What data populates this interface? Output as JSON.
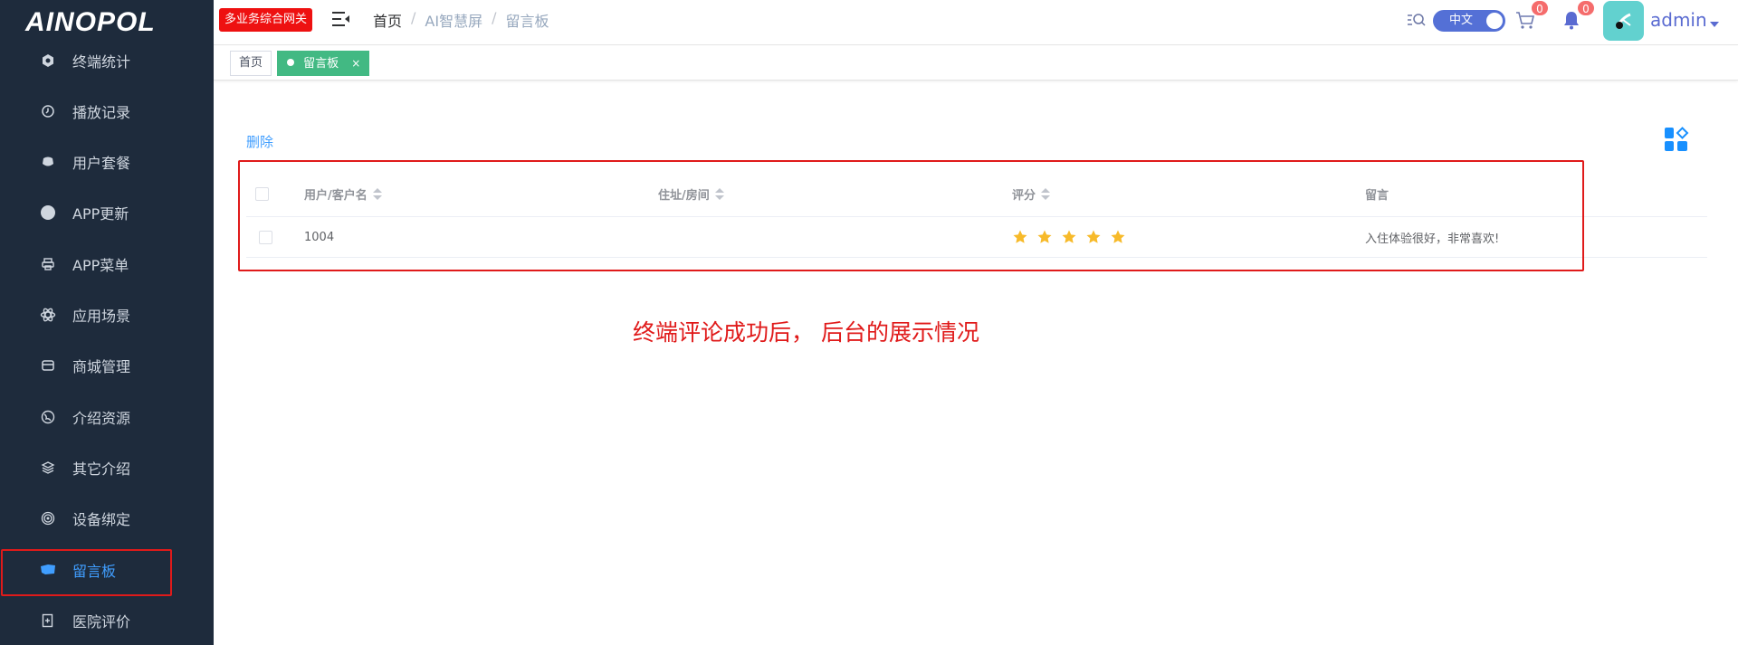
{
  "app": {
    "logo": "AINOPOL",
    "gateway_badge": "多业务综合网关"
  },
  "breadcrumb": [
    "首页",
    "AI智慧屏",
    "留言板"
  ],
  "header": {
    "lang_label": "中文",
    "cart_count": "0",
    "bell_count": "0",
    "username": "admin"
  },
  "sidebar": {
    "items": [
      {
        "label": "终端统计",
        "icon": "hexagon-icon"
      },
      {
        "label": "播放记录",
        "icon": "clock-icon"
      },
      {
        "label": "用户套餐",
        "icon": "package-icon"
      },
      {
        "label": "APP更新",
        "icon": "circle-icon"
      },
      {
        "label": "APP菜单",
        "icon": "printer-icon"
      },
      {
        "label": "应用场景",
        "icon": "atom-icon"
      },
      {
        "label": "商城管理",
        "icon": "shop-icon"
      },
      {
        "label": "介绍资源",
        "icon": "globe-icon"
      },
      {
        "label": "其它介绍",
        "icon": "layers-icon"
      },
      {
        "label": "设备绑定",
        "icon": "target-icon"
      },
      {
        "label": "留言板",
        "icon": "message-icon",
        "active": true
      },
      {
        "label": "医院评价",
        "icon": "document-icon"
      }
    ]
  },
  "tags": [
    {
      "label": "首页"
    },
    {
      "label": "留言板",
      "active": true,
      "close": "×"
    }
  ],
  "toolbar": {
    "delete_label": "删除"
  },
  "table": {
    "columns": [
      "用户/客户名",
      "住址/房间",
      "评分",
      "留言"
    ],
    "rows": [
      {
        "user": "1004",
        "address": "",
        "rating": 5,
        "message": "入住体验很好，非常喜欢!"
      }
    ]
  },
  "annotation": "终端评论成功后， 后台的展示情况",
  "colors": {
    "sidebar_bg": "#1e2b3c",
    "accent": "#409eff",
    "tag_active": "#42b983",
    "highlight": "#e01a1a",
    "star": "#f7ba2a"
  }
}
